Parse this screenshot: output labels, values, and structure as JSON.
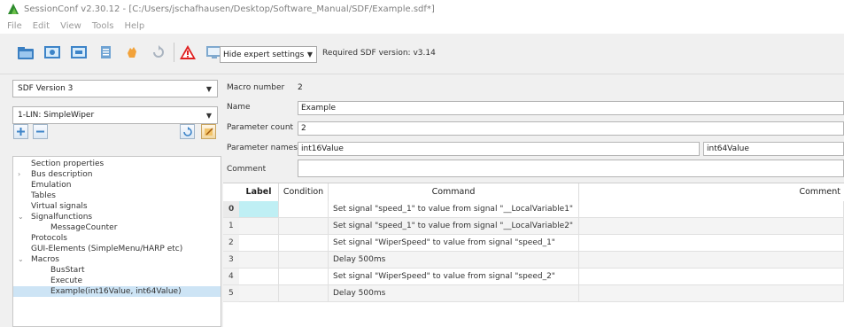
{
  "window": {
    "title": "SessionConf v2.30.12 - [C:/Users/jschafhausen/Desktop/Software_Manual/SDF/Example.sdf*]"
  },
  "menu": [
    "File",
    "Edit",
    "View",
    "Tools",
    "Help"
  ],
  "toolbar": {
    "icons": [
      "open-folder-icon",
      "bus-config-icon",
      "bus-config-2-icon",
      "copy-icon",
      "hand-icon",
      "reload-icon",
      "warning-icon",
      "monitor-icon"
    ],
    "expert_select": "Hide expert settings",
    "required_version": "Required SDF version: v3.14"
  },
  "left": {
    "sdf_version": "SDF Version 3",
    "bus_select": "1-LIN: SimpleWiper",
    "tree": [
      {
        "label": "Section properties",
        "indent": 0,
        "expander": ""
      },
      {
        "label": "Bus description",
        "indent": 0,
        "expander": ">"
      },
      {
        "label": "Emulation",
        "indent": 0,
        "expander": ""
      },
      {
        "label": "Tables",
        "indent": 0,
        "expander": ""
      },
      {
        "label": "Virtual signals",
        "indent": 0,
        "expander": ""
      },
      {
        "label": "Signalfunctions",
        "indent": 0,
        "expander": "v"
      },
      {
        "label": "MessageCounter",
        "indent": 2,
        "expander": ""
      },
      {
        "label": "Protocols",
        "indent": 0,
        "expander": ""
      },
      {
        "label": "GUI-Elements (SimpleMenu/HARP etc)",
        "indent": 0,
        "expander": ""
      },
      {
        "label": "Macros",
        "indent": 0,
        "expander": "v"
      },
      {
        "label": "BusStart",
        "indent": 2,
        "expander": ""
      },
      {
        "label": "Execute",
        "indent": 2,
        "expander": ""
      },
      {
        "label": "Example(int16Value, int64Value)",
        "indent": 2,
        "expander": "",
        "selected": true
      }
    ]
  },
  "form": {
    "macro_number_label": "Macro number",
    "macro_number": "2",
    "name_label": "Name",
    "name_value": "Example",
    "param_count_label": "Parameter count",
    "param_count": "2",
    "param_names_label": "Parameter names",
    "param_name_1": "int16Value",
    "param_name_2": "int64Value",
    "comment_label": "Comment",
    "comment_value": ""
  },
  "table": {
    "headers": {
      "label": "Label",
      "condition": "Condition",
      "command": "Command",
      "comment": "Comment"
    },
    "rows": [
      {
        "num": "0",
        "label": "",
        "condition": "",
        "command": "Set signal \"speed_1\" to value from signal \"__LocalVariable1\"",
        "comment": ""
      },
      {
        "num": "1",
        "label": "",
        "condition": "",
        "command": "Set signal \"speed_1\" to value from signal \"__LocalVariable2\"",
        "comment": ""
      },
      {
        "num": "2",
        "label": "",
        "condition": "",
        "command": "Set signal \"WiperSpeed\" to value from signal \"speed_1\"",
        "comment": ""
      },
      {
        "num": "3",
        "label": "",
        "condition": "",
        "command": "Delay 500ms",
        "comment": ""
      },
      {
        "num": "4",
        "label": "",
        "condition": "",
        "command": "Set signal \"WiperSpeed\" to value from signal \"speed_2\"",
        "comment": ""
      },
      {
        "num": "5",
        "label": "",
        "condition": "",
        "command": "Delay 500ms",
        "comment": ""
      }
    ]
  },
  "colors": {
    "selection": "#cde4f5",
    "active_cell": "#bfeff4"
  }
}
